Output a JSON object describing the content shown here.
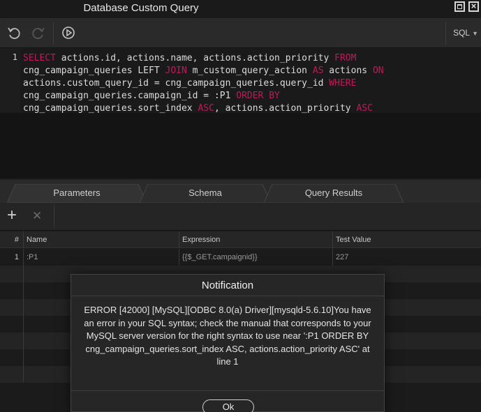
{
  "window": {
    "title": "Database Custom Query"
  },
  "toolbar": {
    "language": "SQL"
  },
  "editor": {
    "line_number": "1",
    "lines": [
      [
        {
          "t": "SELECT",
          "k": 1
        },
        {
          "t": " actions.id, actions.name, actions.action_priority "
        },
        {
          "t": "FROM",
          "k": 1
        }
      ],
      [
        {
          "t": "cng_campaign_queries LEFT "
        },
        {
          "t": "JOIN",
          "k": 1
        },
        {
          "t": " m_custom_query_action "
        },
        {
          "t": "AS",
          "k": 1
        },
        {
          "t": " actions "
        },
        {
          "t": "ON",
          "k": 1
        }
      ],
      [
        {
          "t": "actions.custom_query_id = cng_campaign_queries.query_id "
        },
        {
          "t": "WHERE",
          "k": 1
        }
      ],
      [
        {
          "t": "cng_campaign_queries.campaign_id = :P1 "
        },
        {
          "t": "ORDER BY",
          "k": 1
        }
      ],
      [
        {
          "t": "cng_campaign_queries.sort_index "
        },
        {
          "t": "ASC",
          "k": 1
        },
        {
          "t": ", actions.action_priority "
        },
        {
          "t": "ASC",
          "k": 1
        }
      ]
    ]
  },
  "tabs": [
    {
      "label": "Parameters",
      "active": true
    },
    {
      "label": "Schema",
      "active": false
    },
    {
      "label": "Query Results",
      "active": false
    }
  ],
  "grid": {
    "columns": [
      "#",
      "Name",
      "Expression",
      "Test Value"
    ],
    "rows": [
      {
        "num": "1",
        "name": ":P1",
        "expression": "{{$_GET.campaignid}}",
        "test_value": "227"
      }
    ]
  },
  "notification": {
    "title": "Notification",
    "message": "ERROR [42000] [MySQL][ODBC 8.0(a) Driver][mysqld-5.6.10]You have an error in your SQL syntax; check the manual that corresponds to your MySQL server version for the right syntax to use near ':P1 ORDER BY cng_campaign_queries.sort_index ASC, actions.action_priority ASC' at line 1",
    "ok_label": "Ok"
  },
  "colors": {
    "keyword": "#c2185b",
    "background": "#1e1e1e",
    "editor_bg": "#1a1a1a"
  }
}
